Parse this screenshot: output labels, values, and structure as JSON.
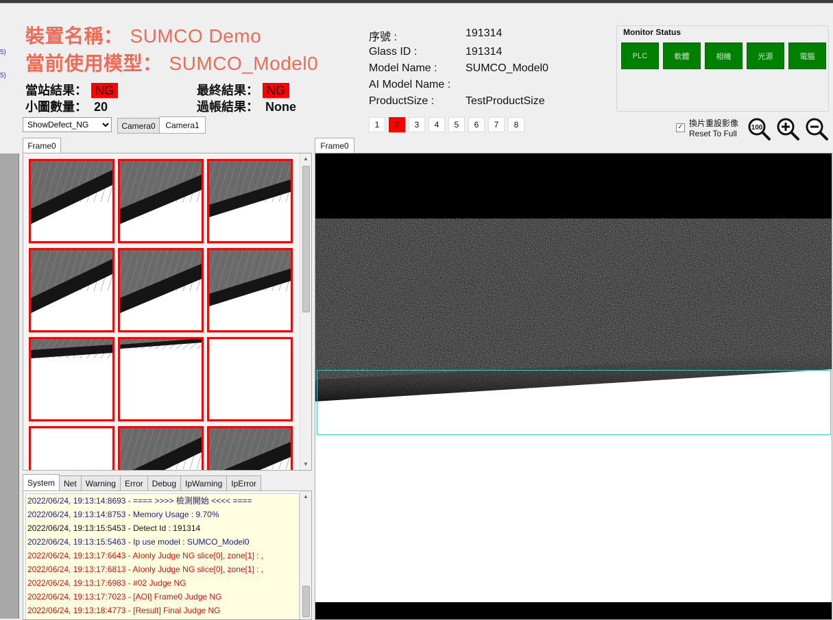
{
  "header": {
    "device_label": "裝置名稱：",
    "device_value": "SUMCO Demo",
    "model_label": "當前使用模型：",
    "model_value": "SUMCO_Model0"
  },
  "results": {
    "station_label": "當站結果：",
    "station_value": "NG",
    "final_label": "最終結果：",
    "final_value": "NG",
    "count_label": "小圖數量：",
    "count_value": "20",
    "pass_label": "過帳結果：",
    "pass_value": "None"
  },
  "info": [
    {
      "label": "序號 :",
      "value": "191314"
    },
    {
      "label": "Glass ID :",
      "value": "191314"
    },
    {
      "label": "Model Name :",
      "value": "SUMCO_Model0"
    },
    {
      "label": "AI Model Name :",
      "value": ""
    },
    {
      "label": "ProductSize :",
      "value": "TestProductSize"
    }
  ],
  "pages": [
    "1",
    "2",
    "3",
    "4",
    "5",
    "6",
    "7",
    "8"
  ],
  "active_page": "2",
  "monitor": {
    "title": "Monitor Status",
    "buttons": [
      "PLC",
      "軟體",
      "相機",
      "光源",
      "電腦"
    ],
    "status_color": "#008000"
  },
  "reset": {
    "label_zh": "換片重設影像",
    "label_en": "Reset To Full",
    "checked": true
  },
  "zoom": {
    "reset_label": "100",
    "icons": [
      "zoom-100-icon",
      "zoom-in-icon",
      "zoom-out-icon"
    ]
  },
  "controls": {
    "filter_value": "ShowDefect_NG",
    "camera_tabs": [
      "Camera0",
      "Camera1"
    ],
    "active_camera": "Camera1"
  },
  "thumb_panel": {
    "tab": "Frame0"
  },
  "viewer": {
    "tab": "Frame0",
    "roi_color": "#3ec7d4"
  },
  "log": {
    "tabs": [
      "System",
      "Net",
      "Warning",
      "Error",
      "Debug",
      "IpWarning",
      "IpError"
    ],
    "active_tab": "System",
    "lines": [
      {
        "text": "2022/06/24, 19:13:14:8693 - ==== >>>> 檢測開始 <<<< ====",
        "color": "#1a1a8c"
      },
      {
        "text": "2022/06/24, 19:13:14:8753 - Memory Usage : 9.70%",
        "color": "#1a1a8c"
      },
      {
        "text": "2022/06/24, 19:13:15:5453 - Detect Id : 191314",
        "color": "#111111"
      },
      {
        "text": "2022/06/24, 19:13:15:5463 - Ip use model : SUMCO_Model0",
        "color": "#1a1a8c"
      },
      {
        "text": "2022/06/24, 19:13:17:6643 - AIonly Judge NG slice[0], zone[1] : ,",
        "color": "#d01010"
      },
      {
        "text": "2022/06/24, 19:13:17:6813 - AIonly Judge NG slice[0], zone[1] : ,",
        "color": "#d01010"
      },
      {
        "text": "2022/06/24, 19:13:17:6983 - #02 Judge NG",
        "color": "#d01010"
      },
      {
        "text": "2022/06/24, 19:13:17:7023 - [AOI] Frame0 Judge NG",
        "color": "#d01010"
      },
      {
        "text": "2022/06/24, 19:13:18:4773 - [Result] Final Judge NG",
        "color": "#d01010"
      }
    ]
  },
  "colors": {
    "header_accent": "#ef6b55",
    "ng_badge": "#ff0000",
    "thumb_border": "#e01010",
    "log_background": "#fffee0"
  }
}
